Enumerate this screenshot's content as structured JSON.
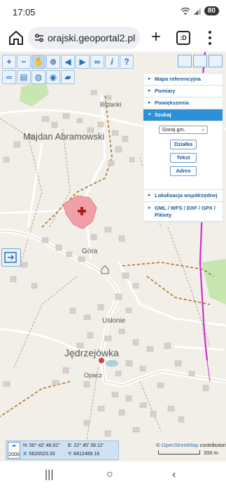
{
  "status_bar": {
    "time": "17:05",
    "battery": "80"
  },
  "browser": {
    "url": "orajski.geoportal2.pl"
  },
  "map": {
    "labels": {
      "brdanki": "Brdanki",
      "majdan": "Majdan Abramowski",
      "gora": "Góra",
      "uslonie": "Usłonie",
      "jedrzejowka": "Jędrzejówka",
      "opacz": "Opacz"
    }
  },
  "panel": {
    "items": [
      {
        "label": "Mapa referencyjna"
      },
      {
        "label": "Pomiary"
      },
      {
        "label": "Powiększenia"
      },
      {
        "label": "Szukaj"
      }
    ],
    "search": {
      "select_value": "Goraj gm.",
      "buttons": [
        "Działka",
        "Tekst",
        "Adres"
      ]
    },
    "items_after": [
      {
        "label": "Lokalizacja współrzędnej"
      },
      {
        "label": "GML / WFS / DXF / GPX / Pikiety"
      }
    ]
  },
  "coords": {
    "scale": "2000",
    "n": "N:  50° 42' 48.91\"",
    "e": "E:  22° 45' 39.11\"",
    "x": "X:  5620523.33",
    "y": "Y:  8412489.16"
  },
  "attribution": {
    "prefix": "©",
    "osm": "OpenStreetMap",
    "suffix": "contributors"
  },
  "scale_label": "200 m",
  "colors": {
    "accent": "#2d8fd5",
    "parcel": "#f2a0a8",
    "cross": "#b01c1c"
  }
}
